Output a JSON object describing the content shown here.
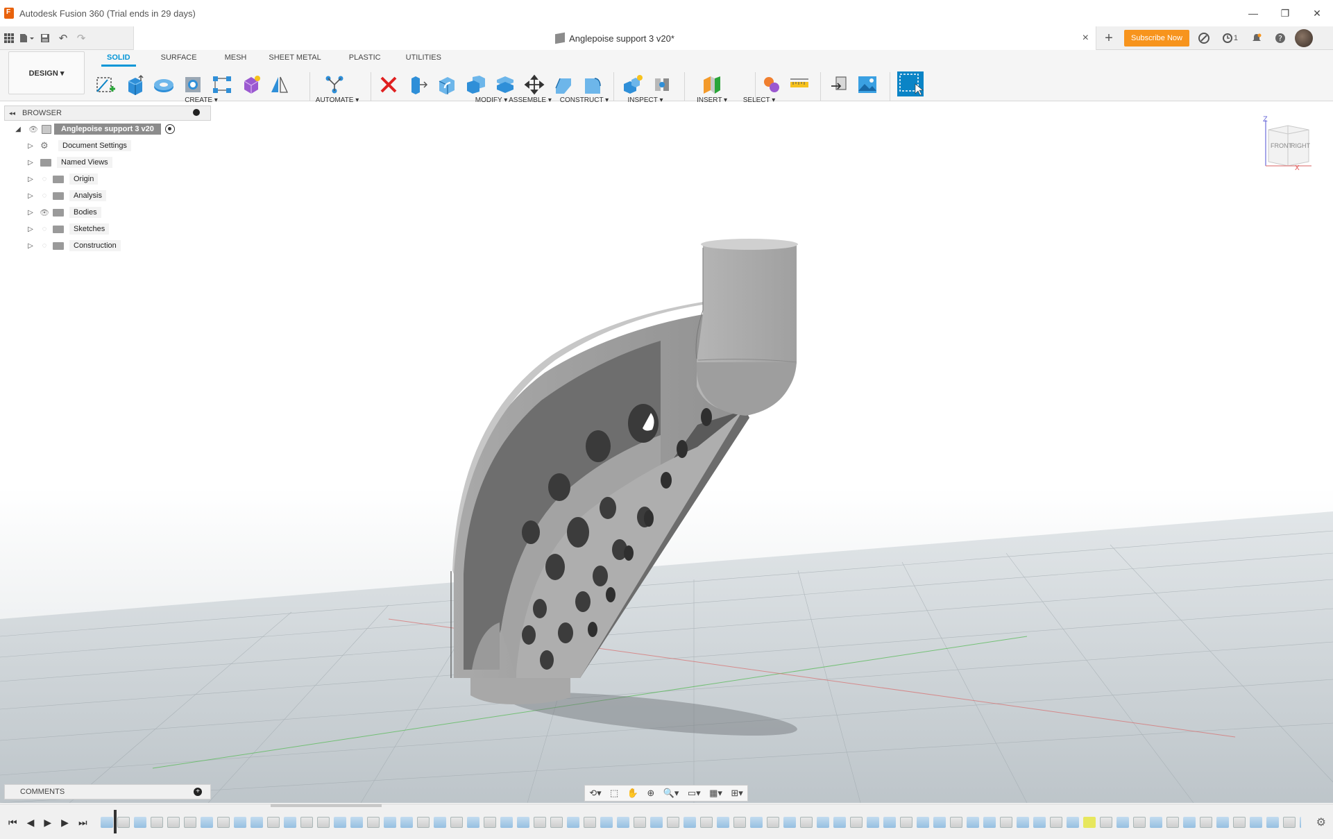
{
  "window": {
    "title": "Autodesk Fusion 360 (Trial ends in 29 days)",
    "minimize": "—",
    "restore": "❐",
    "close": "✕"
  },
  "docbar": {
    "document_title": "Anglepoise support 3 v20*",
    "close_tab": "×",
    "subscribe_label": "Subscribe Now",
    "jobs_count": "1",
    "add_tab": "+"
  },
  "ribbon": {
    "workspace_label": "DESIGN ▾",
    "tabs": [
      "SOLID",
      "SURFACE",
      "MESH",
      "SHEET METAL",
      "PLASTIC",
      "UTILITIES"
    ],
    "active_tab": "SOLID",
    "groups": {
      "create": "CREATE ▾",
      "automate": "AUTOMATE ▾",
      "modify": "MODIFY ▾",
      "assemble": "ASSEMBLE ▾",
      "construct": "CONSTRUCT ▾",
      "inspect": "INSPECT ▾",
      "insert": "INSERT ▾",
      "select": "SELECT ▾"
    }
  },
  "browser": {
    "header": "BROWSER",
    "root": "Anglepoise support 3 v20",
    "items": [
      {
        "label": "Document Settings",
        "icon": "gear-icon"
      },
      {
        "label": "Named Views",
        "icon": "folder-icon"
      },
      {
        "label": "Origin",
        "icon": "folder-icon",
        "visible": false
      },
      {
        "label": "Analysis",
        "icon": "folder-icon",
        "visible": false
      },
      {
        "label": "Bodies",
        "icon": "folder-icon",
        "visible": true
      },
      {
        "label": "Sketches",
        "icon": "folder-icon",
        "visible": false
      },
      {
        "label": "Construction",
        "icon": "folder-icon",
        "visible": false
      }
    ]
  },
  "viewcube": {
    "front": "FRONT",
    "right": "RIGHT",
    "z_axis": "Z",
    "x_axis": "X"
  },
  "comments": {
    "header": "COMMENTS"
  },
  "colors": {
    "accent": "#0696d7",
    "subscribe": "#f7941d",
    "model_body": "#9a9a9a",
    "grid": "#a9b1b5"
  }
}
